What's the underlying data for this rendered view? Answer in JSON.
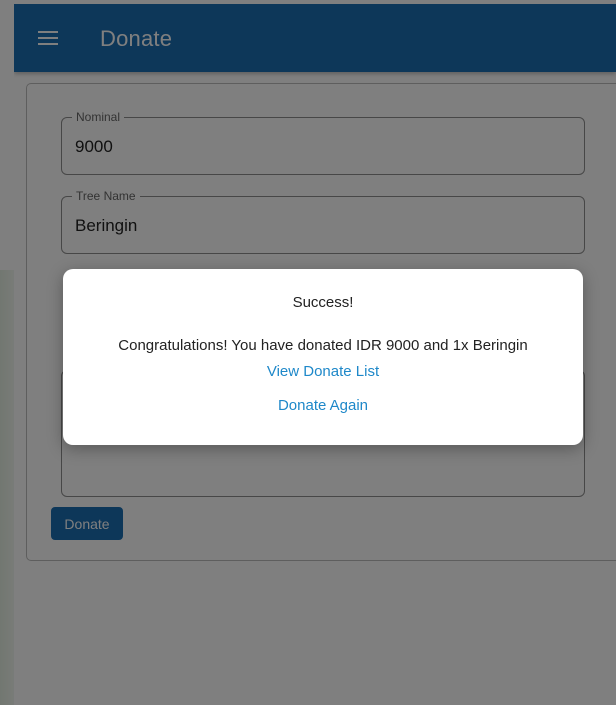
{
  "appbar": {
    "title": "Donate",
    "menu_icon": "hamburger-menu-icon",
    "color": "#1b6fb3"
  },
  "form": {
    "nominal": {
      "label": "Nominal",
      "value": "9000"
    },
    "tree_name": {
      "label": "Tree Name",
      "value": "Beringin"
    },
    "message": {
      "value": ""
    },
    "donate_button_label": "Donate"
  },
  "dialog": {
    "title": "Success!",
    "message": "Congratulations! You have donated IDR 9000 and 1x Beringin",
    "view_list_label": "View Donate List",
    "donate_again_label": "Donate Again",
    "link_color": "#1e88c9"
  }
}
